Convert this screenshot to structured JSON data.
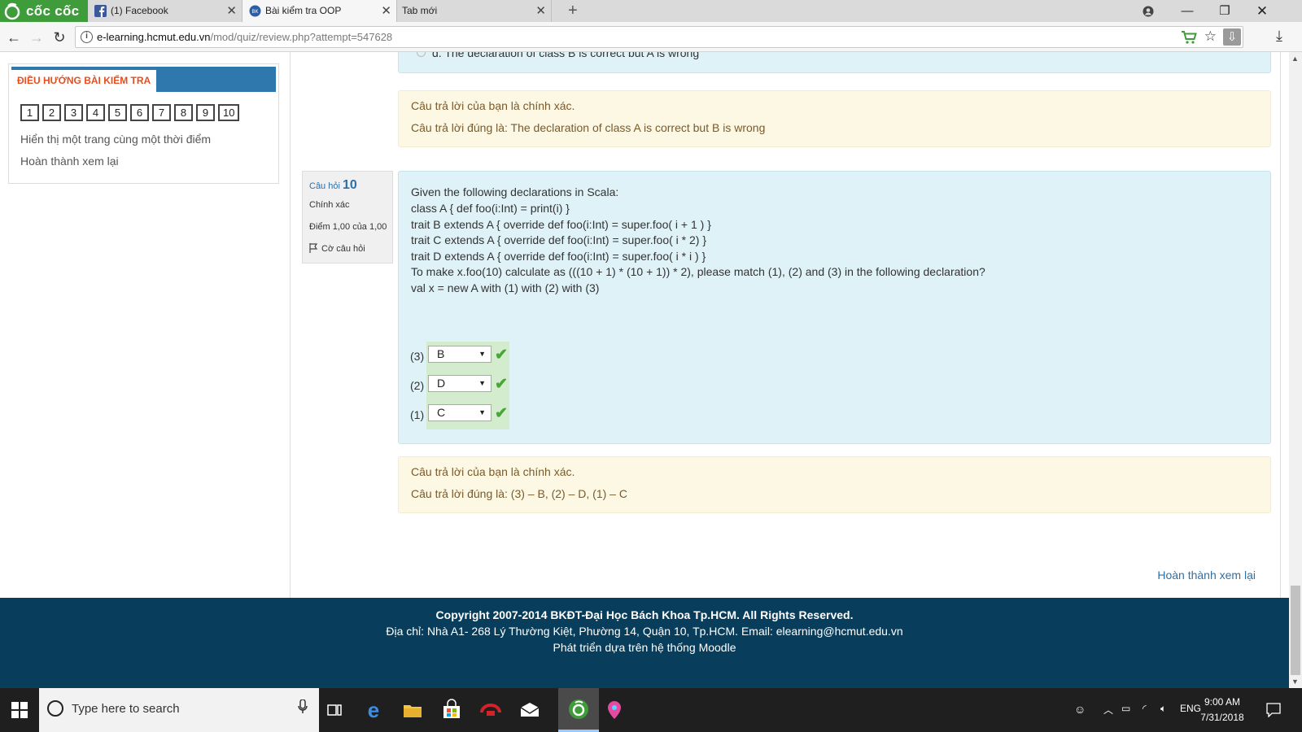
{
  "browser": {
    "brand": "cốc cốc",
    "tabs": [
      {
        "title": "(1) Facebook"
      },
      {
        "title": "Bài kiểm tra OOP"
      },
      {
        "title": "Tab mới"
      }
    ],
    "url_host": "e-learning.hcmut.edu.vn",
    "url_path": "/mod/quiz/review.php?attempt=547628"
  },
  "sidebar": {
    "header": "ĐIỀU HƯỚNG BÀI KIỂM TRA",
    "question_buttons": [
      "1",
      "2",
      "3",
      "4",
      "5",
      "6",
      "7",
      "8",
      "9",
      "10"
    ],
    "show_one_page": "Hiển thị một trang cùng một thời điểm",
    "finish_review": "Hoàn thành xem lại"
  },
  "prev_question": {
    "last_option": "d. The declaration of class B is correct but A is wrong",
    "feedback": "Câu trả lời của bạn là chính xác.",
    "right_answer": "Câu trả lời đúng là: The declaration of class A is correct but B is wrong"
  },
  "question": {
    "label": "Câu hỏi",
    "number": "10",
    "state": "Chính xác",
    "grade": "Điểm 1,00 của 1,00",
    "flag": "Cờ câu hỏi",
    "text_lines": [
      "Given the following declarations in Scala:",
      "class A { def foo(i:Int) = print(i) }",
      "trait B extends A { override def foo(i:Int) = super.foo( i + 1 ) }",
      "trait C extends A { override def foo(i:Int) = super.foo( i * 2) }",
      "trait D extends A { override def foo(i:Int) = super.foo( i * i ) }",
      "To make x.foo(10) calculate as (((10 + 1) * (10 + 1)) * 2), please match (1), (2) and (3) in the following declaration?",
      "val x = new A with (1) with (2) with (3)"
    ],
    "matches": [
      {
        "label": "(3)",
        "value": "B"
      },
      {
        "label": "(2)",
        "value": "D"
      },
      {
        "label": "(1)",
        "value": "C"
      }
    ],
    "feedback": "Câu trả lời của bạn là chính xác.",
    "right_answer": "Câu trả lời đúng là: (3) – B, (2) – D, (1) – C"
  },
  "finish_link": "Hoàn thành xem lại",
  "footer": {
    "copyright": "Copyright 2007-2014 BKĐT-Đại Học Bách Khoa Tp.HCM. All Rights Reserved.",
    "address": "Địa chỉ: Nhà A1- 268 Lý Thường Kiệt, Phường 14, Quận 10, Tp.HCM. Email: elearning@hcmut.edu.vn",
    "moodle": "Phát triển dựa trên hệ thống Moodle"
  },
  "taskbar": {
    "search_placeholder": "Type here to search",
    "lang": "ENG",
    "time": "9:00 AM",
    "date": "7/31/2018"
  },
  "colors": {
    "brand_green": "#3e9d3a",
    "nav_header_blue": "#2f78ad",
    "question_bg": "#def2f8",
    "feedback_bg": "#fcf8e3",
    "footer_bg": "#083e5c",
    "correct_green": "#4aa43a"
  }
}
